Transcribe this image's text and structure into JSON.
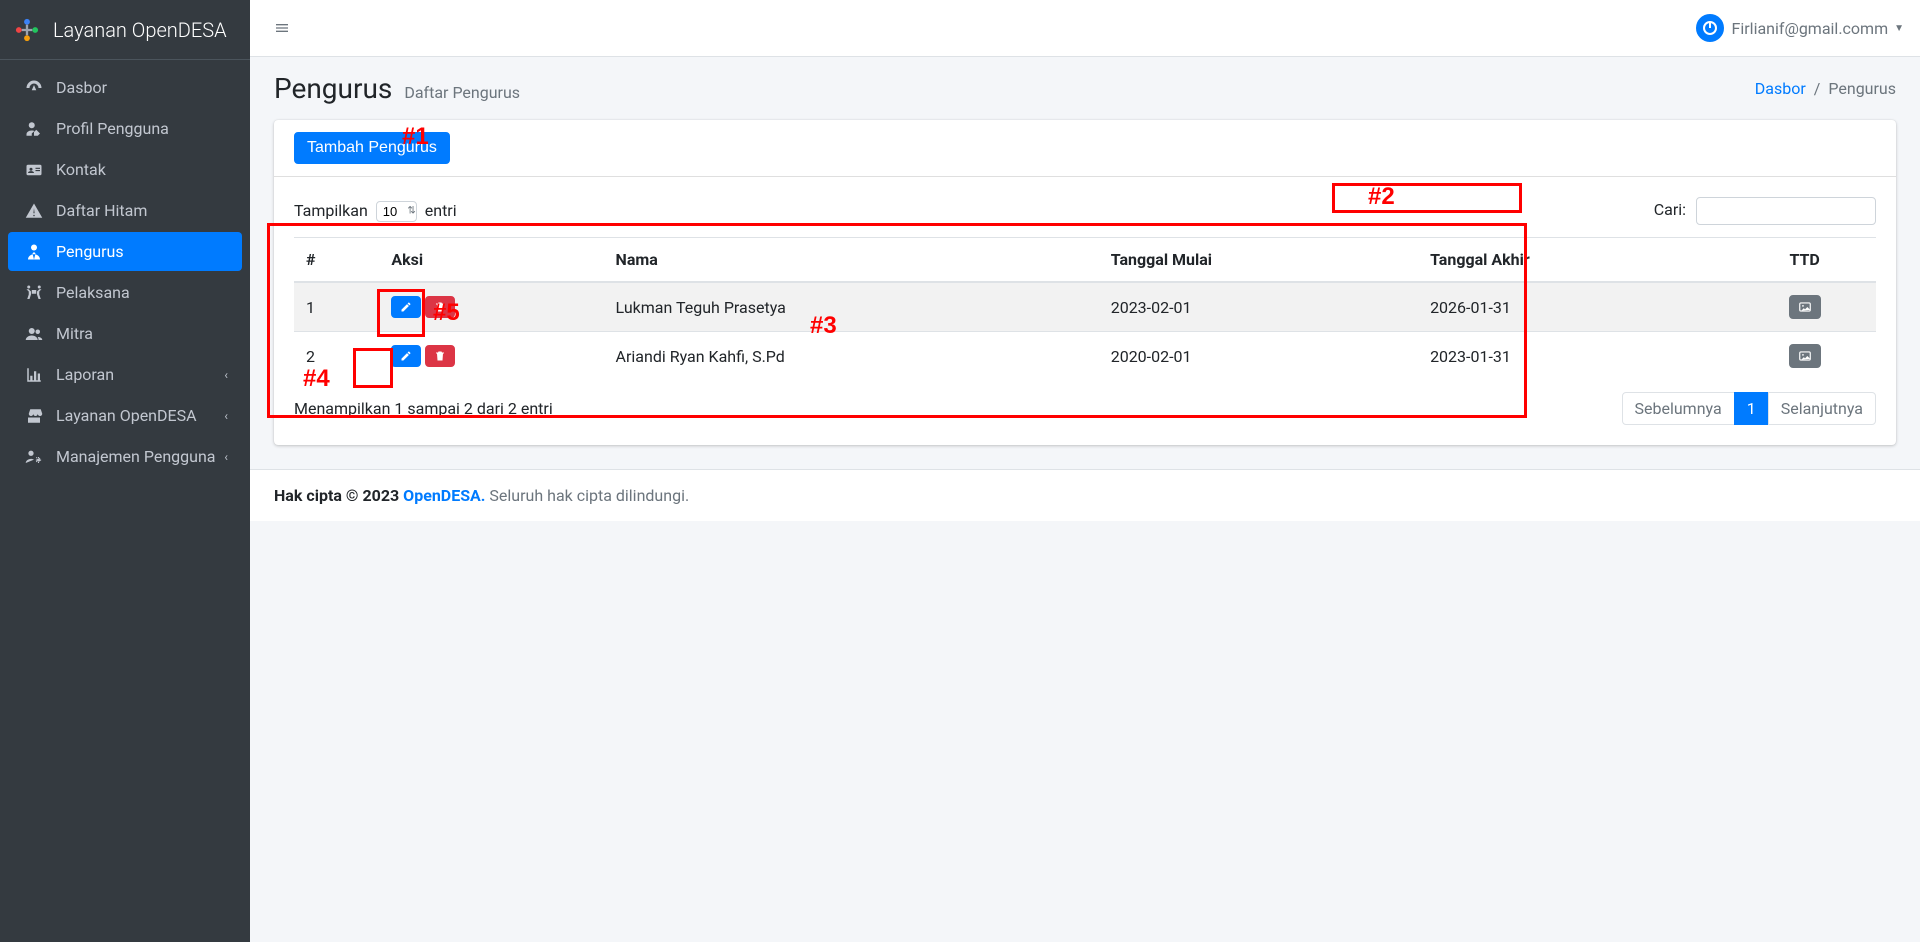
{
  "brand": {
    "name": "Layanan OpenDESA"
  },
  "user": {
    "name": "Firlianif@gmail.comm"
  },
  "sidebar": {
    "items": [
      {
        "label": "Dasbor",
        "icon": "dashboard",
        "active": false,
        "has_children": false
      },
      {
        "label": "Profil Pengguna",
        "icon": "user-edit",
        "active": false,
        "has_children": false
      },
      {
        "label": "Kontak",
        "icon": "address-card",
        "active": false,
        "has_children": false
      },
      {
        "label": "Daftar Hitam",
        "icon": "exclamation-triangle",
        "active": false,
        "has_children": false
      },
      {
        "label": "Pengurus",
        "icon": "user-tie",
        "active": true,
        "has_children": false
      },
      {
        "label": "Pelaksana",
        "icon": "people-carry",
        "active": false,
        "has_children": false
      },
      {
        "label": "Mitra",
        "icon": "users",
        "active": false,
        "has_children": false
      },
      {
        "label": "Laporan",
        "icon": "chart-bar",
        "active": false,
        "has_children": true
      },
      {
        "label": "Layanan OpenDESA",
        "icon": "store",
        "active": false,
        "has_children": true
      },
      {
        "label": "Manajemen Pengguna",
        "icon": "users-cog",
        "active": false,
        "has_children": true
      }
    ]
  },
  "header": {
    "title": "Pengurus",
    "subtitle": "Daftar Pengurus"
  },
  "breadcrumb": {
    "root": "Dasbor",
    "current": "Pengurus"
  },
  "actions": {
    "add_label": "Tambah Pengurus"
  },
  "datatable": {
    "length_prefix": "Tampilkan",
    "length_suffix": "entri",
    "length_value": "10",
    "search_label": "Cari:",
    "search_value": "",
    "columns": [
      "#",
      "Aksi",
      "Nama",
      "Tanggal Mulai",
      "Tanggal Akhir",
      "TTD"
    ],
    "rows": [
      {
        "no": "1",
        "nama": "Lukman Teguh Prasetya",
        "mulai": "2023-02-01",
        "akhir": "2026-01-31"
      },
      {
        "no": "2",
        "nama": "Ariandi Ryan Kahfi, S.Pd",
        "mulai": "2020-02-01",
        "akhir": "2023-01-31"
      }
    ],
    "info": "Menampilkan 1 sampai 2 dari 2 entri",
    "prev_label": "Sebelumnya",
    "next_label": "Selanjutnya",
    "page": "1"
  },
  "footer": {
    "copyright_prefix": "Hak cipta © 2023 ",
    "brand": "OpenDESA.",
    "copyright_suffix": " Seluruh hak cipta dilindungi."
  },
  "annotations": {
    "a1": "#1",
    "a2": "#2",
    "a3": "#3",
    "a4": "#4",
    "a5": "#5"
  }
}
